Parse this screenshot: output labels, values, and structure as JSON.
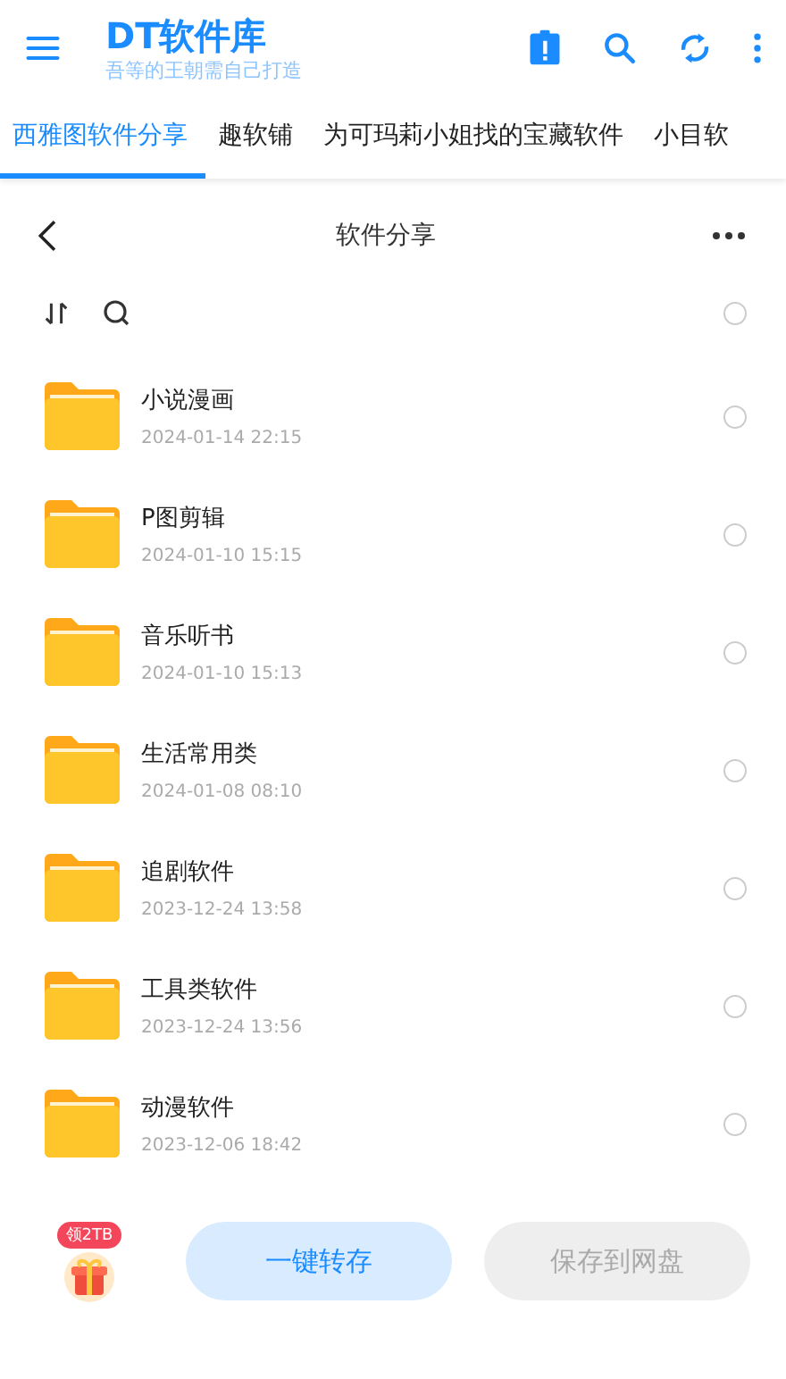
{
  "app_bar": {
    "title": "DT软件库",
    "subtitle": "吾等的王朝需自己打造"
  },
  "tabs": [
    {
      "label": "西雅图软件分享",
      "selected": true
    },
    {
      "label": "趣软铺",
      "selected": false
    },
    {
      "label": "为可玛莉小姐找的宝藏软件",
      "selected": false
    },
    {
      "label": "小目软",
      "selected": false
    }
  ],
  "folder_header": {
    "title": "软件分享"
  },
  "toolbar": {
    "select_all": {
      "checked": false
    }
  },
  "folders": [
    {
      "name": "小说漫画",
      "date": "2024-01-14 22:15",
      "checked": false
    },
    {
      "name": "P图剪辑",
      "date": "2024-01-10 15:15",
      "checked": false
    },
    {
      "name": "音乐听书",
      "date": "2024-01-10 15:13",
      "checked": false
    },
    {
      "name": "生活常用类",
      "date": "2024-01-08 08:10",
      "checked": false
    },
    {
      "name": "追剧软件",
      "date": "2023-12-24 13:58",
      "checked": false
    },
    {
      "name": "工具类软件",
      "date": "2023-12-24 13:56",
      "checked": false
    },
    {
      "name": "动漫软件",
      "date": "2023-12-06 18:42",
      "checked": false
    }
  ],
  "bottom_bar": {
    "gift_badge": "领2TB",
    "buttons": [
      {
        "label": "一键转存",
        "disabled": false
      },
      {
        "label": "保存到网盘",
        "disabled": true
      }
    ]
  }
}
